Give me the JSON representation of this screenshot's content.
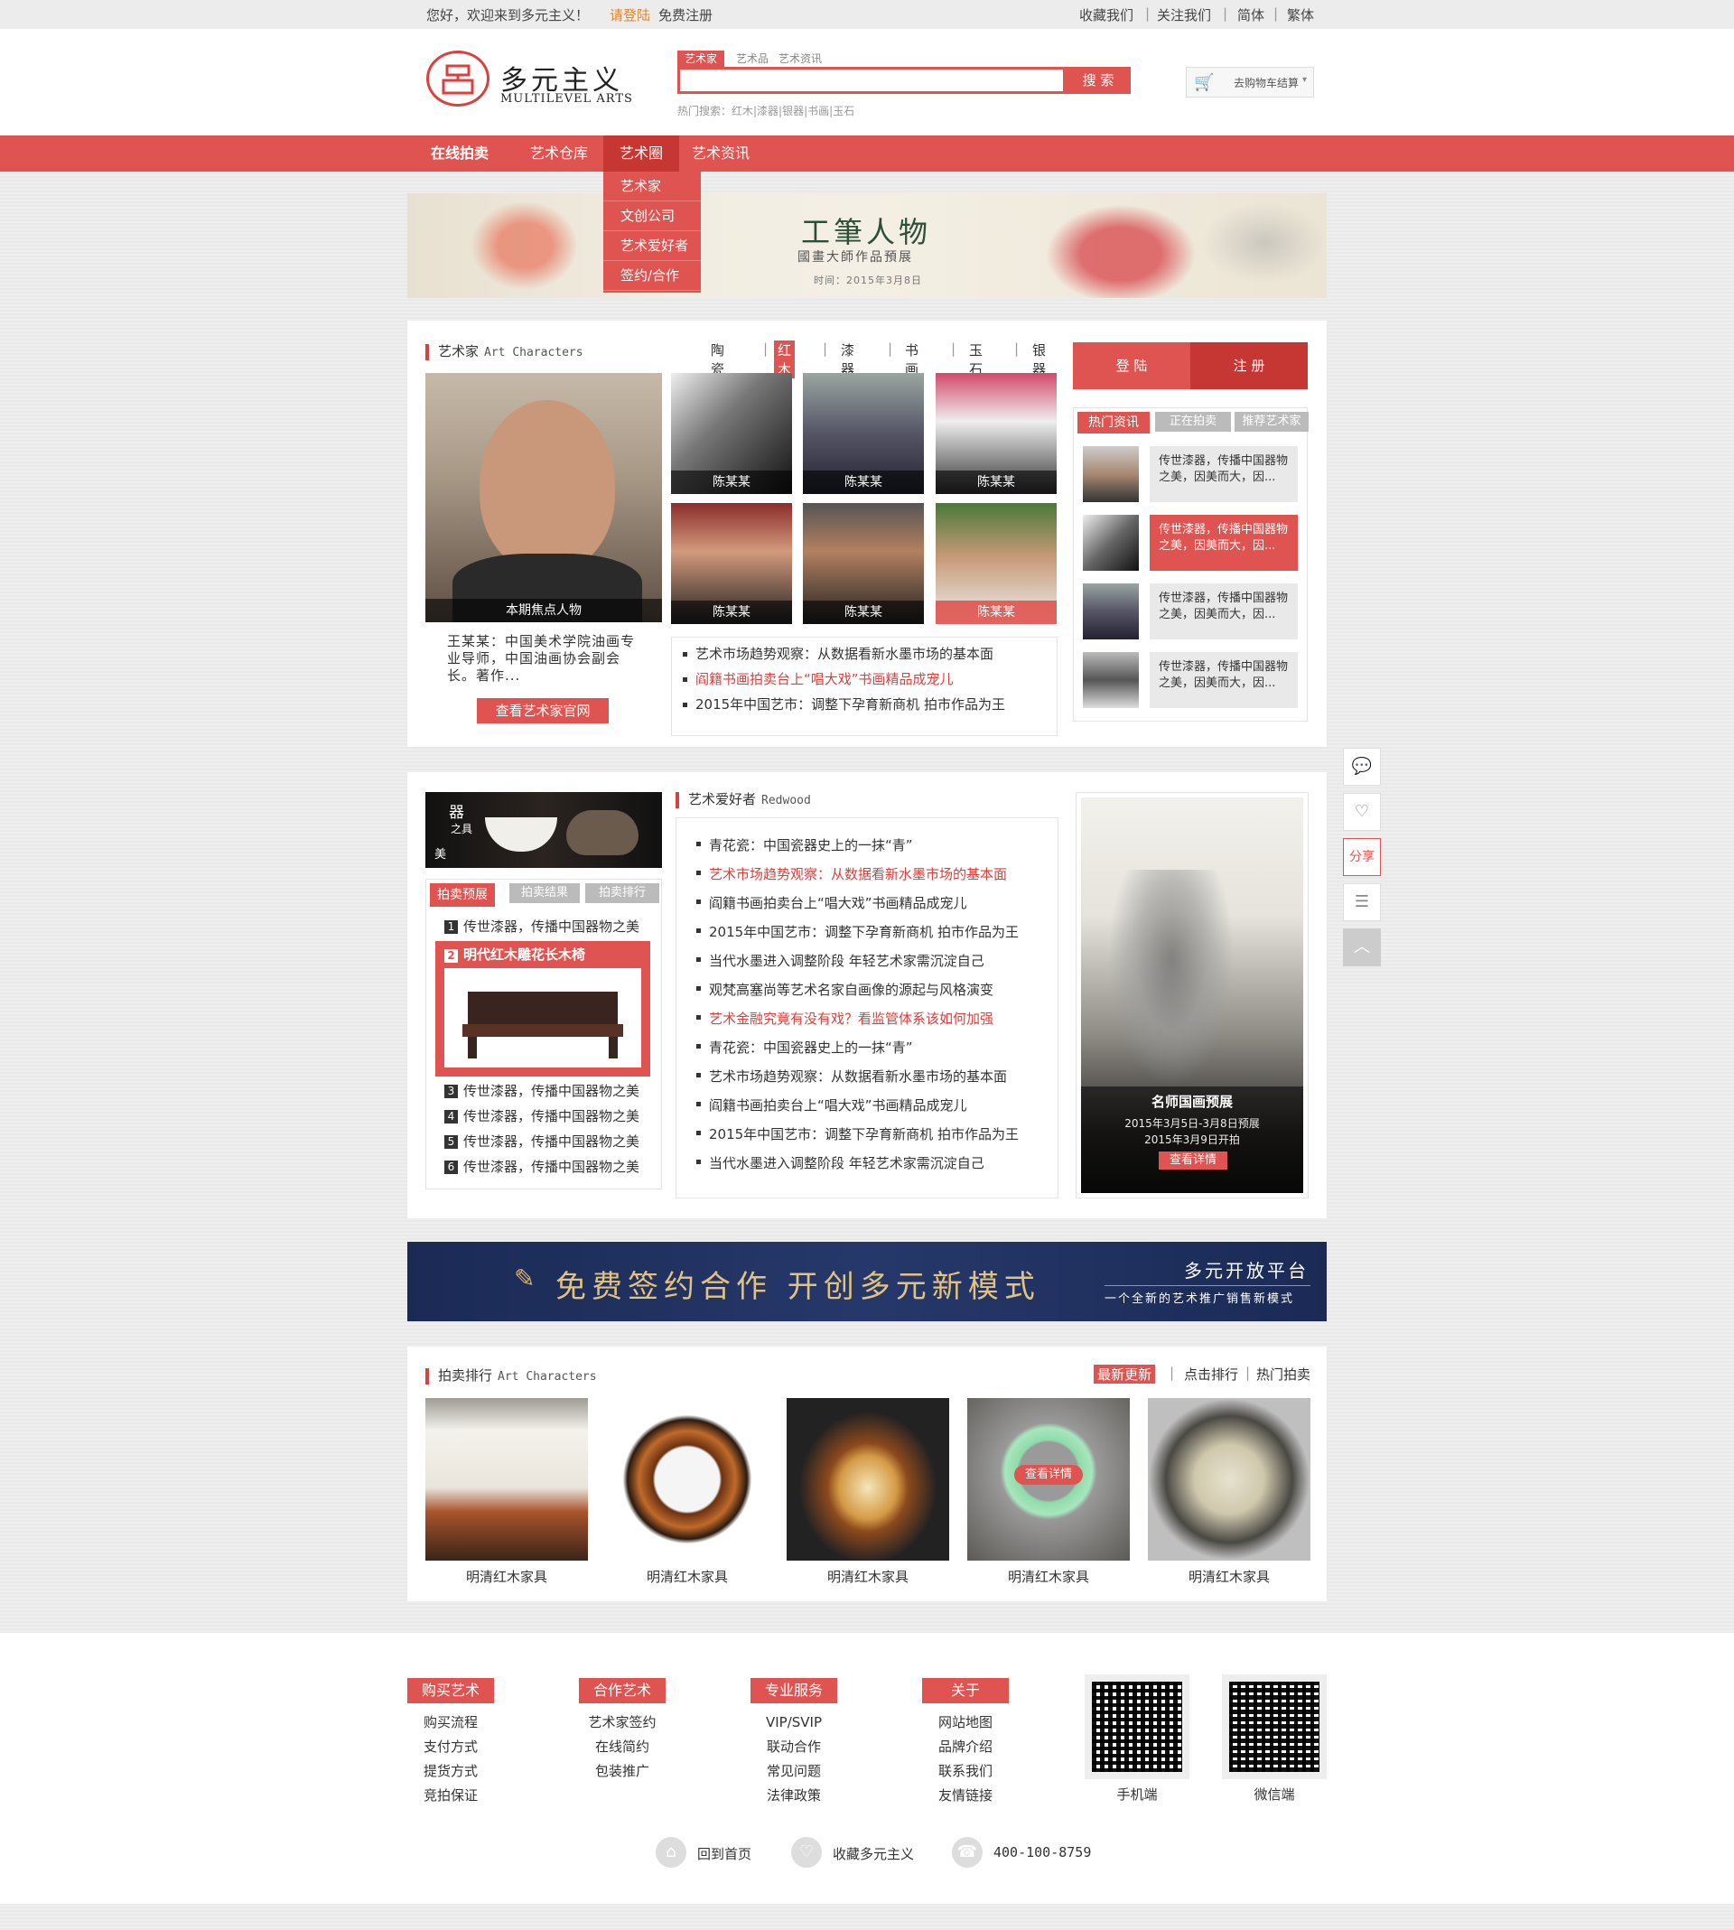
{
  "topbar": {
    "welcome": "您好，欢迎来到多元主义！",
    "login": "请登陆",
    "register": "免费注册",
    "links": [
      "收藏我们",
      "关注我们",
      "简体",
      "繁体"
    ]
  },
  "header": {
    "logo_cn": "多元主义",
    "logo_en": "MULTILEVEL ARTS",
    "search_tabs": [
      "艺术家",
      "艺术品",
      "艺术资讯"
    ],
    "search_button": "搜 索",
    "hot_label": "热门搜索：",
    "hot_terms": "红木|漆器|银器|书画|玉石",
    "cart": "去购物车结算"
  },
  "nav": {
    "items": [
      "在线拍卖",
      "艺术仓库",
      "艺术圈",
      "艺术资讯"
    ],
    "dropdown": [
      "艺术家",
      "文创公司",
      "艺术爱好者",
      "签约/合作"
    ]
  },
  "banner1": {
    "title": "工筆人物",
    "subtitle": "國畫大師作品預展",
    "date": "时间：2015年3月8日"
  },
  "artists": {
    "title": "艺术家",
    "title_en": "Art Characters",
    "categories": [
      "陶瓷",
      "红木",
      "漆器",
      "书画",
      "玉石",
      "银器"
    ],
    "focus_caption": "本期焦点人物",
    "focus_desc": "王某某：中国美术学院油画专业导师，中国油画协会副会长。著作...",
    "focus_button": "查看艺术家官网",
    "grid_names": [
      "陈某某",
      "陈某某",
      "陈某某",
      "陈某某",
      "陈某某",
      "陈某某"
    ],
    "news": [
      "艺术市场趋势观察：从数据看新水墨市场的基本面",
      "阎籍书画拍卖台上“唱大戏”书画精品成宠儿",
      "2015年中国艺市：调整下孕育新商机 拍市作品为王"
    ]
  },
  "auth": {
    "login": "登 陆",
    "register": "注 册"
  },
  "right_tabs": [
    "热门资讯",
    "正在拍卖",
    "推荐艺术家"
  ],
  "right_news": [
    "传世漆器，传播中国器物之美，因美而大，因...",
    "传世漆器，传播中国器物之美，因美而大，因...",
    "传世漆器，传播中国器物之美，因美而大，因...",
    "传世漆器，传播中国器物之美，因美而大，因..."
  ],
  "section2": {
    "promo_text_1": "器",
    "promo_text_2": "之具",
    "promo_text_3": "美",
    "auction_tabs": [
      "拍卖预展",
      "拍卖结果",
      "拍卖排行"
    ],
    "rank": [
      {
        "num": "1",
        "text": "传世漆器，传播中国器物之美"
      },
      {
        "num": "2",
        "text": "明代红木雕花长木椅"
      },
      {
        "num": "3",
        "text": "传世漆器，传播中国器物之美"
      },
      {
        "num": "4",
        "text": "传世漆器，传播中国器物之美"
      },
      {
        "num": "5",
        "text": "传世漆器，传播中国器物之美"
      },
      {
        "num": "6",
        "text": "传世漆器，传播中国器物之美"
      }
    ],
    "lovers_title": "艺术爱好者",
    "lovers_title_en": "Redwood",
    "lovers_news": [
      "青花瓷：中国瓷器史上的一抹“青”",
      "艺术市场趋势观察：从数据看新水墨市场的基本面",
      "阎籍书画拍卖台上“唱大戏”书画精品成宠儿",
      "2015年中国艺市：调整下孕育新商机 拍市作品为王",
      "当代水墨进入调整阶段 年轻艺术家需沉淀自己",
      "观梵高塞尚等艺术名家自画像的源起与风格演变",
      "艺术金融究竟有没有戏？看监管体系该如何加强",
      "青花瓷：中国瓷器史上的一抹“青”",
      "艺术市场趋势观察：从数据看新水墨市场的基本面",
      "阎籍书画拍卖台上“唱大戏”书画精品成宠儿",
      "2015年中国艺市：调整下孕育新商机 拍市作品为王",
      "当代水墨进入调整阶段 年轻艺术家需沉淀自己"
    ],
    "painting_title": "名师国画预展",
    "painting_line1": "2015年3月5日-3月8日预展",
    "painting_line2": "2015年3月9日开拍",
    "painting_button": "查看详情"
  },
  "banner2": {
    "main": "免费签约合作 开创多元新模式",
    "right_title": "多元开放平台",
    "right_sub": "一个全新的艺术推广销售新模式"
  },
  "ranking": {
    "title": "拍卖排行",
    "title_en": "Art Characters",
    "sort": [
      "最新更新",
      "点击排行",
      "热门拍卖"
    ],
    "items": [
      "明清红木家具",
      "明清红木家具",
      "明清红木家具",
      "明清红木家具",
      "明清红木家具"
    ],
    "detail_button": "查看详情"
  },
  "footer": {
    "cols": [
      {
        "head": "购买艺术",
        "items": [
          "购买流程",
          "支付方式",
          "提货方式",
          "竞拍保证"
        ]
      },
      {
        "head": "合作艺术",
        "items": [
          "艺术家签约",
          "在线简约",
          "包装推广"
        ]
      },
      {
        "head": "专业服务",
        "items": [
          "VIP/SVIP",
          "联动合作",
          "常见问题",
          "法律政策"
        ]
      },
      {
        "head": "关于",
        "items": [
          "网站地图",
          "品牌介绍",
          "联系我们",
          "友情链接"
        ]
      }
    ],
    "qr": [
      "手机端",
      "微信端"
    ],
    "bottom": [
      "回到首页",
      "收藏多元主义",
      "400-100-8759"
    ]
  },
  "side": {
    "share": "分享"
  },
  "colors": {
    "accent": "#df5450",
    "navy": "#1f2f5c"
  }
}
